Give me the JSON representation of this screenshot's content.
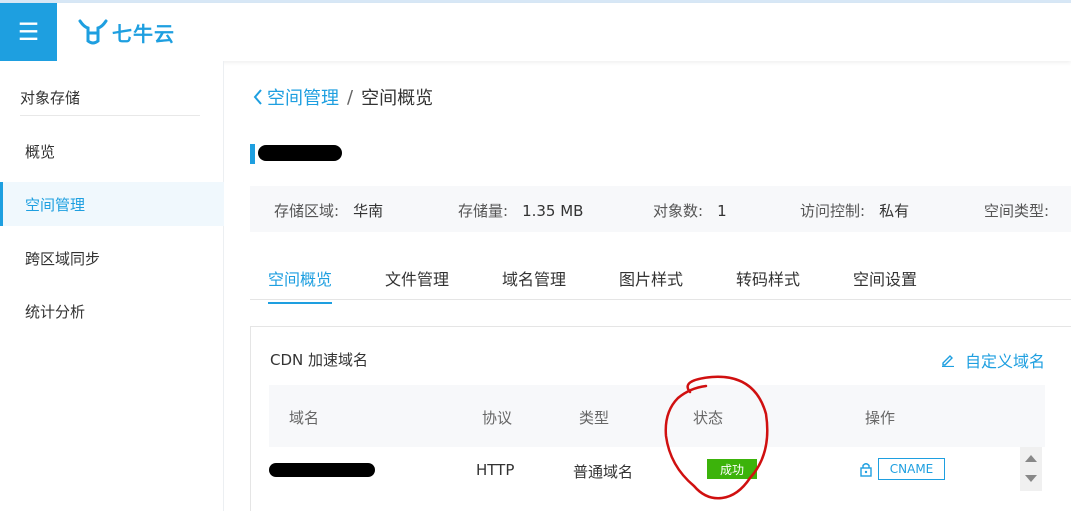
{
  "header": {
    "brand": "七牛云",
    "accent_color": "#1e9fe0",
    "menu_icon": "hamburger-icon",
    "logo_icon": "bull-logo-icon"
  },
  "sidebar": {
    "header": "对象存储",
    "items": [
      {
        "label": "概览",
        "active": false
      },
      {
        "label": "空间管理",
        "active": true
      },
      {
        "label": "跨区域同步",
        "active": false
      },
      {
        "label": "统计分析",
        "active": false
      }
    ]
  },
  "breadcrumb": {
    "parent": "空间管理",
    "separator": "/",
    "current": "空间概览"
  },
  "info": {
    "region_label": "存储区域:",
    "region_value": "华南",
    "storage_label": "存储量:",
    "storage_value": "1.35 MB",
    "objects_label": "对象数:",
    "objects_value": "1",
    "access_label": "访问控制:",
    "access_value": "私有",
    "type_label": "空间类型:"
  },
  "tabs": [
    {
      "label": "空间概览",
      "active": true
    },
    {
      "label": "文件管理",
      "active": false
    },
    {
      "label": "域名管理",
      "active": false
    },
    {
      "label": "图片样式",
      "active": false
    },
    {
      "label": "转码样式",
      "active": false
    },
    {
      "label": "空间设置",
      "active": false
    }
  ],
  "cdn": {
    "title": "CDN 加速域名",
    "custom_link": "自定义域名",
    "edit_icon": "pencil-icon",
    "columns": [
      "域名",
      "协议",
      "类型",
      "状态",
      "操作"
    ],
    "rows": [
      {
        "protocol": "HTTP",
        "type": "普通域名",
        "status": "成功",
        "action": "CNAME",
        "status_color": "#3cb30b"
      }
    ],
    "lock_icon": "lock-icon"
  }
}
